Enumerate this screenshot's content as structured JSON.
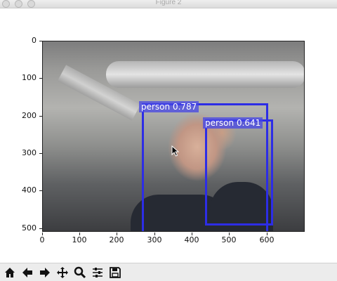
{
  "window": {
    "title": "Figure 2"
  },
  "axes": {
    "y_ticks": [
      "0",
      "100",
      "200",
      "300",
      "400",
      "500"
    ],
    "x_ticks": [
      "0",
      "100",
      "200",
      "300",
      "400",
      "500",
      "600"
    ]
  },
  "detections": [
    {
      "label": "person 0.787"
    },
    {
      "label": "person 0.641"
    }
  ],
  "toolbar": {
    "icons": [
      "home-icon",
      "back-arrow-icon",
      "forward-arrow-icon",
      "pan-icon",
      "zoom-icon",
      "configure-subplots-icon",
      "save-icon"
    ]
  },
  "colors": {
    "bbox": "#2d2de6",
    "label_bg": "#4646e6"
  }
}
